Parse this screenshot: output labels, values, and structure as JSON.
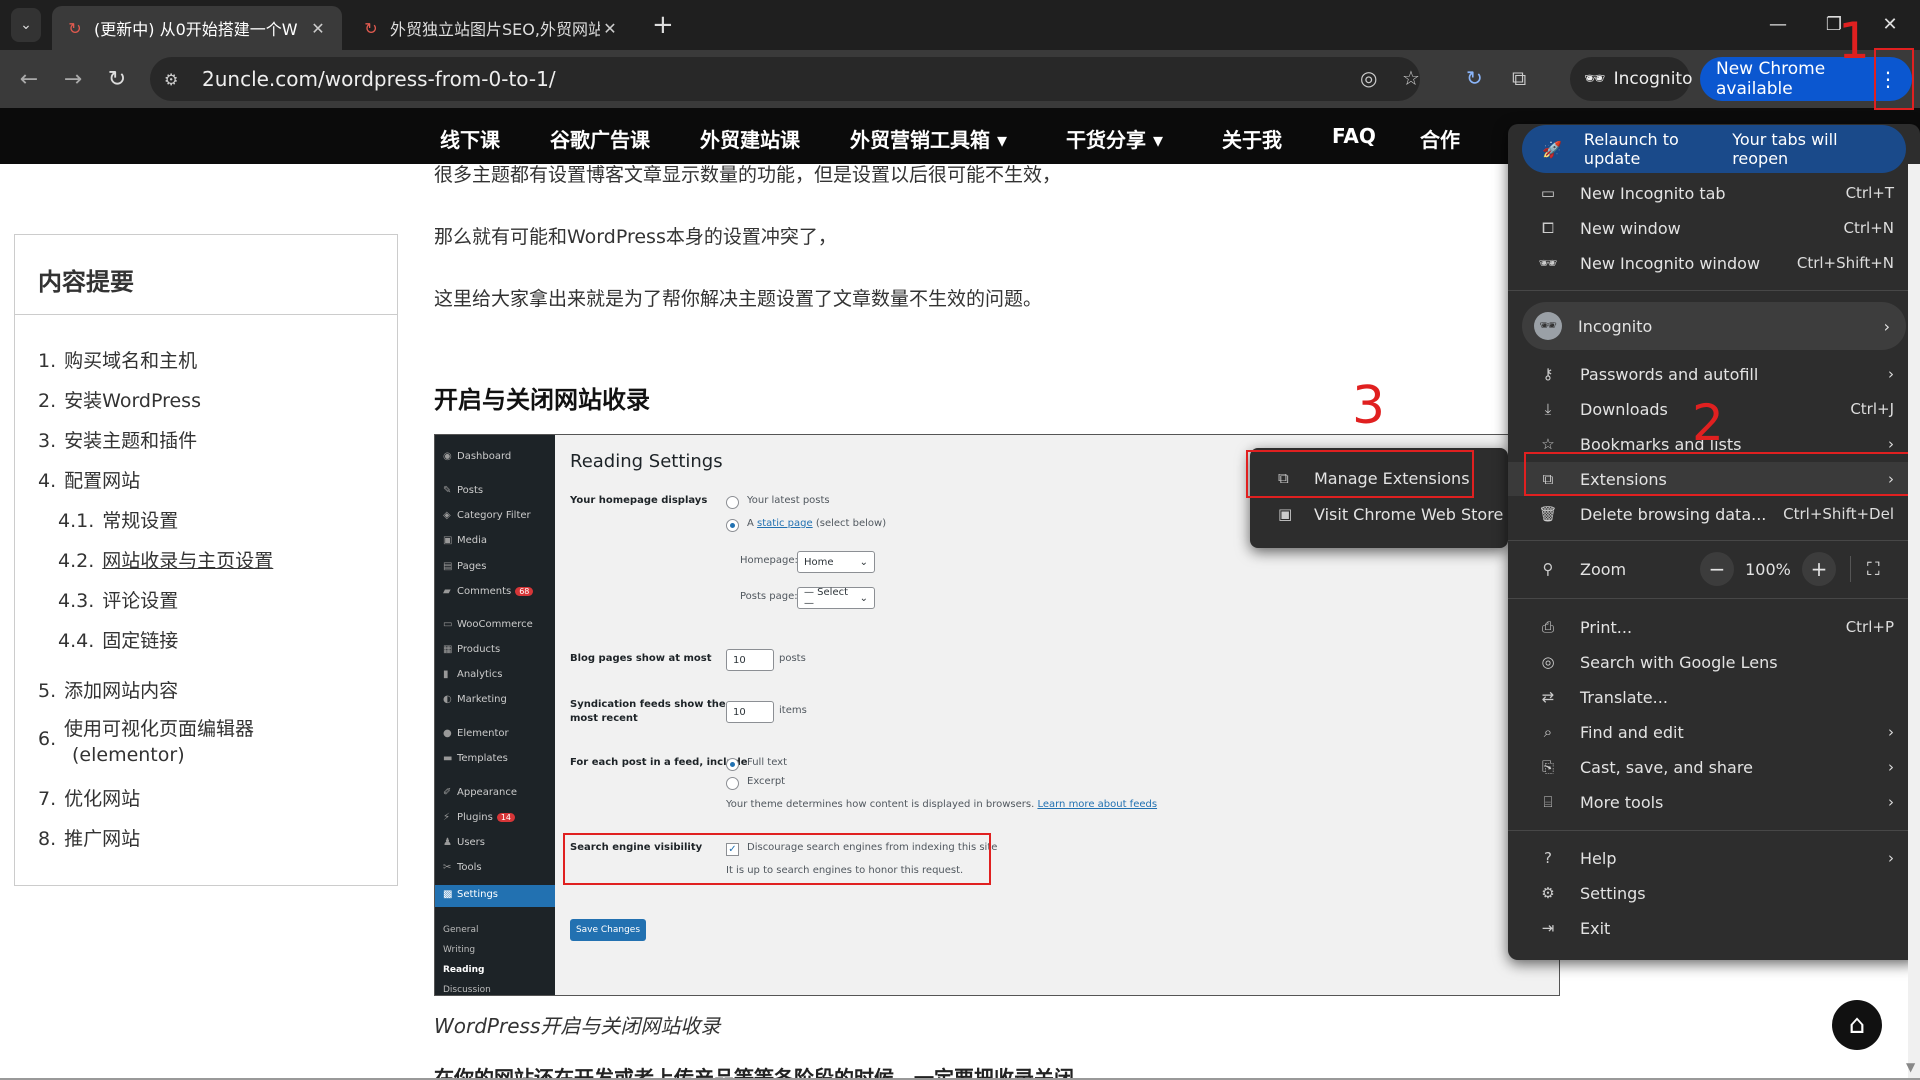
{
  "browser": {
    "tabs": [
      {
        "title": "(更新中) 从0开始搭建一个W",
        "active": true
      },
      {
        "title": "外贸独立站图片SEO,外贸网站",
        "active": false
      }
    ],
    "url": "2uncle.com/wordpress-from-0-to-1/",
    "incognito_label": "Incognito",
    "update_label": "New Chrome available"
  },
  "site_nav": [
    "线下课",
    "谷歌广告课",
    "外贸建站课",
    "外贸营销工具箱",
    "干货分享",
    "关于我",
    "FAQ",
    "合作"
  ],
  "toc": {
    "title": "内容提要",
    "items": [
      {
        "num": "1.",
        "label": "购买域名和主机"
      },
      {
        "num": "2.",
        "label": "安装WordPress"
      },
      {
        "num": "3.",
        "label": "安装主题和插件"
      },
      {
        "num": "4.",
        "label": "配置网站"
      },
      {
        "num": "4.1.",
        "label": "常规设置"
      },
      {
        "num": "4.2.",
        "label": "网站收录与主页设置"
      },
      {
        "num": "4.3.",
        "label": "评论设置"
      },
      {
        "num": "4.4.",
        "label": "固定链接"
      },
      {
        "num": "5.",
        "label": "添加网站内容"
      },
      {
        "num": "6.",
        "label": "使用可视化页面编辑器",
        "label2": "(elementor)"
      },
      {
        "num": "7.",
        "label": "优化网站"
      },
      {
        "num": "8.",
        "label": "推广网站"
      }
    ]
  },
  "article": {
    "p1": "很多主题都有设置博客文章显示数量的功能，但是设置以后很可能不生效，",
    "p2": "那么就有可能和WordPress本身的设置冲突了，",
    "p3": "这里给大家拿出来就是为了帮你解决主题设置了文章数量不生效的问题。",
    "heading": "开启与关闭网站收录",
    "caption": "WordPress开启与关闭网站收录",
    "last_line": "在你的网站还在开发或者上传产品等等各阶段的时候，一定要把收录关闭"
  },
  "wp_screenshot": {
    "menu": [
      "Dashboard",
      "Posts",
      "Category Filter",
      "Media",
      "Pages",
      "Comments",
      "WooCommerce",
      "Products",
      "Analytics",
      "Marketing",
      "Elementor",
      "Templates",
      "Appearance",
      "Plugins",
      "Users",
      "Tools",
      "Settings"
    ],
    "comments_badge": "68",
    "plugins_badge": "14",
    "submenu": [
      "General",
      "Writing",
      "Reading",
      "Discussion"
    ],
    "title": "Reading Settings",
    "homepage_displays": "Your homepage displays",
    "latest_posts": "Your latest posts",
    "static_a": "A",
    "static_link": "static page",
    "static_rest": "(select below)",
    "homepage_label": "Homepage:",
    "homepage_value": "Home",
    "postspage_label": "Posts page:",
    "postspage_value": "— Select —",
    "blog_pages_label": "Blog pages show at most",
    "blog_pages_value": "10",
    "posts_unit": "posts",
    "synd_label1": "Syndication feeds show the",
    "synd_label2": "most recent",
    "synd_value": "10",
    "items_unit": "items",
    "feed_label": "For each post in a feed, include",
    "full_text": "Full text",
    "excerpt": "Excerpt",
    "theme_note": "Your theme determines how content is displayed in browsers.",
    "learn_more": "Learn more about feeds",
    "sev_label": "Search engine visibility",
    "discourage": "Discourage search engines from indexing this site",
    "honor": "It is up to search engines to honor this request.",
    "save": "Save Changes"
  },
  "chrome_menu": {
    "relaunch": "Relaunch to update",
    "relaunch_hint": "Your tabs will reopen",
    "new_incog_tab": "New Incognito tab",
    "new_incog_tab_sc": "Ctrl+T",
    "new_window": "New window",
    "new_window_sc": "Ctrl+N",
    "new_incog_window": "New Incognito window",
    "new_incog_window_sc": "Ctrl+Shift+N",
    "incognito": "Incognito",
    "passwords": "Passwords and autofill",
    "downloads": "Downloads",
    "downloads_sc": "Ctrl+J",
    "bookmarks": "Bookmarks and lists",
    "extensions": "Extensions",
    "delete": "Delete browsing data...",
    "delete_sc": "Ctrl+Shift+Del",
    "zoom": "Zoom",
    "zoom_value": "100%",
    "print": "Print...",
    "print_sc": "Ctrl+P",
    "lens": "Search with Google Lens",
    "translate": "Translate...",
    "find": "Find and edit",
    "cast": "Cast, save, and share",
    "more_tools": "More tools",
    "help": "Help",
    "settings": "Settings",
    "exit": "Exit"
  },
  "ext_submenu": {
    "manage": "Manage Extensions",
    "store": "Visit Chrome Web Store"
  },
  "annotations": {
    "n1": "1",
    "n2": "2",
    "n3": "3"
  },
  "colors": {
    "annotation_red": "#e02020",
    "chrome_blue": "#0b57d0",
    "wp_blue": "#2271b1"
  }
}
